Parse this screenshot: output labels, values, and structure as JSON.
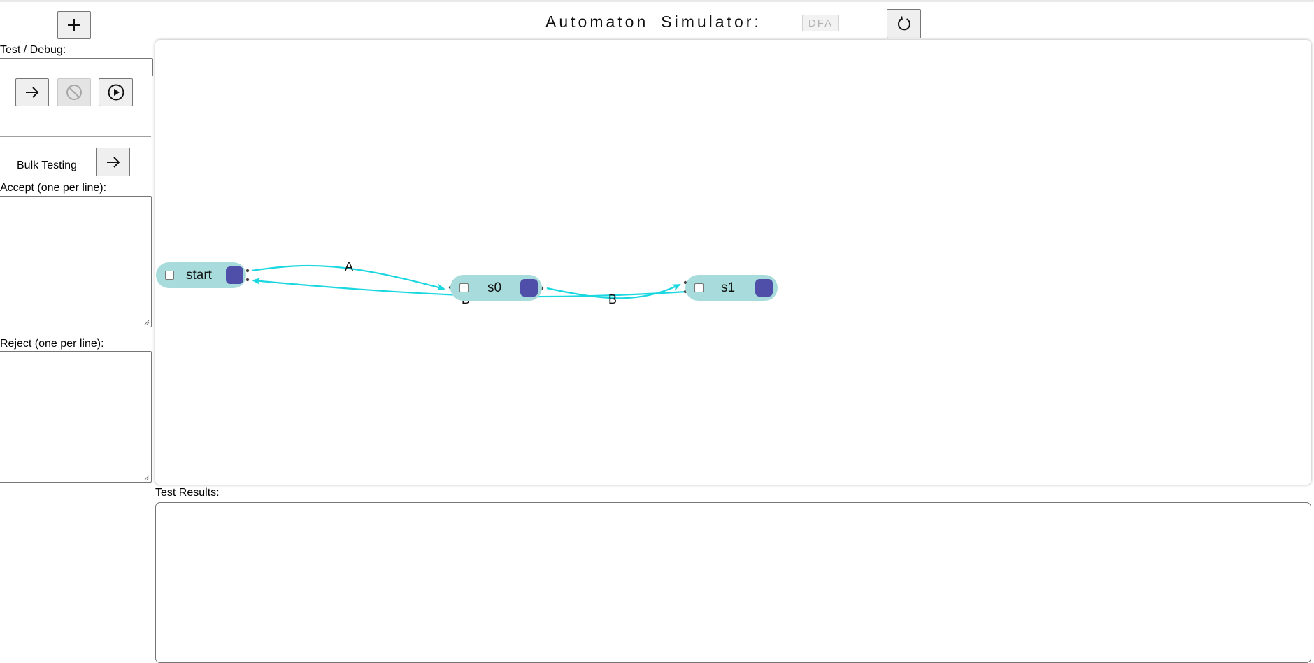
{
  "header": {
    "add_icon": "plus-icon",
    "title_word1": "Automaton",
    "title_word2": "Simulator:",
    "mode": "DFA",
    "reset_icon": "refresh-icon"
  },
  "sidebar": {
    "debug_label": "Test / Debug:",
    "debug_value": "",
    "step_icon": "arrow-right-icon",
    "stop_icon": "cancel-icon",
    "play_icon": "play-circle-icon",
    "bulk_label": "Bulk Testing",
    "bulk_run_icon": "arrow-right-icon",
    "accept_label": "Accept (one per line):",
    "accept_value": "",
    "reject_label": "Reject (one per line):",
    "reject_value": ""
  },
  "graph": {
    "states": [
      {
        "name": "start",
        "accepting_toggle_color": "#4f4fa9"
      },
      {
        "name": "s0",
        "accepting_toggle_color": "#4f4fa9"
      },
      {
        "name": "s1",
        "accepting_toggle_color": "#4f4fa9"
      }
    ],
    "transitions": [
      {
        "from": "start",
        "to": "s0",
        "symbol": "A"
      },
      {
        "from": "s0",
        "to": "start",
        "symbol": "B"
      },
      {
        "from": "s0",
        "to": "s1",
        "symbol": "B"
      }
    ],
    "node_color": "#a8dcdc",
    "edge_color": "#1ad7e0"
  },
  "results": {
    "label": "Test Results:",
    "content": ""
  }
}
